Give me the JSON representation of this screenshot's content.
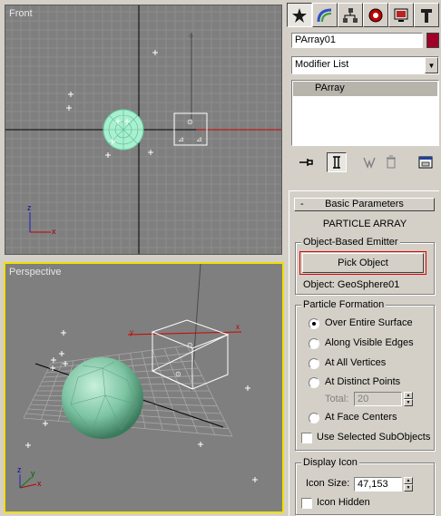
{
  "viewports": {
    "front": {
      "label": "Front"
    },
    "perspective": {
      "label": "Perspective"
    }
  },
  "command_panel": {
    "tabs": [
      {
        "name": "create",
        "icon": "create-star-icon"
      },
      {
        "name": "modify",
        "icon": "modify-rainbow-icon"
      },
      {
        "name": "hierarchy",
        "icon": "hierarchy-icon"
      },
      {
        "name": "motion",
        "icon": "motion-icon"
      },
      {
        "name": "display",
        "icon": "display-monitor-icon"
      },
      {
        "name": "utilities",
        "icon": "utilities-hammer-icon"
      }
    ],
    "object_name": "PArray01",
    "object_color": "#a00028",
    "modifier_list": "Modifier List",
    "stack_items": [
      "PArray"
    ]
  },
  "basic_parameters": {
    "rollout_title": "Basic Parameters",
    "collapse_symbol": "-",
    "heading": "PARTICLE ARRAY",
    "emitter_group": "Object-Based Emitter",
    "pick_button": "Pick Object",
    "object_label": "Object: GeoSphere01",
    "formation_group": "Particle Formation",
    "formation_options": [
      {
        "label": "Over Entire Surface",
        "selected": true
      },
      {
        "label": "Along Visible Edges",
        "selected": false
      },
      {
        "label": "At All Vertices",
        "selected": false
      },
      {
        "label": "At Distinct Points",
        "selected": false
      },
      {
        "label": "At Face Centers",
        "selected": false
      }
    ],
    "total_label": "Total:",
    "total_value": "20",
    "use_selected_label": "Use Selected SubObjects",
    "display_group": "Display Icon",
    "icon_size_label": "Icon Size:",
    "icon_size_value": "47,153",
    "icon_hidden_label": "Icon Hidden"
  },
  "axis_labels": {
    "x": "x",
    "y": "y",
    "z": "z"
  }
}
